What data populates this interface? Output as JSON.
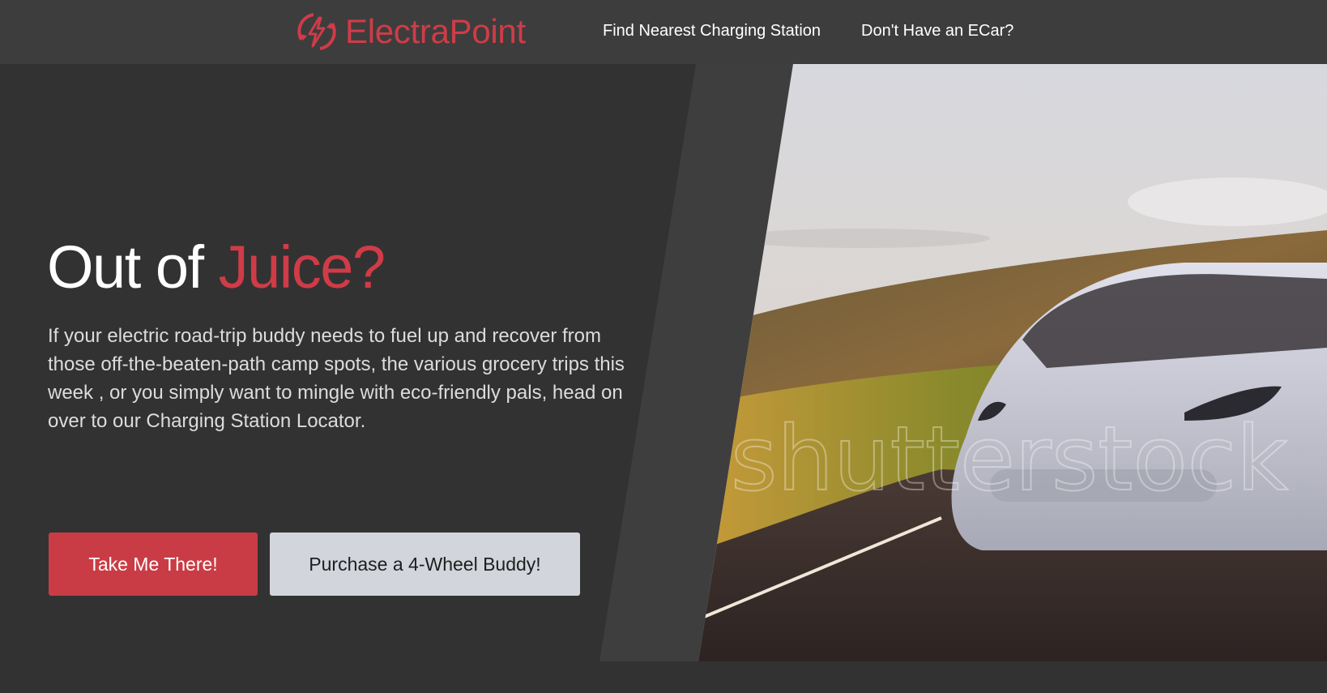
{
  "brand": {
    "name": "ElectraPoint",
    "icon": "lightning-bolt-icon",
    "color": "#cf3c47"
  },
  "nav": {
    "links": [
      {
        "label": "Find Nearest Charging Station"
      },
      {
        "label": "Don't Have an ECar?"
      }
    ]
  },
  "hero": {
    "headline_prefix": "Out of ",
    "headline_accent": "Juice?",
    "body": "If your electric road-trip buddy needs to fuel up and recover from those off-the-beaten-path camp spots, the various grocery trips this week , or you simply want to mingle with eco-friendly pals, head on over to our Charging Station Locator.",
    "primary_button": "Take Me There!",
    "secondary_button": "Purchase a 4-Wheel Buddy!",
    "watermark": "shutterstock"
  },
  "colors": {
    "accent": "#cf3c47",
    "button_primary": "#c93c45",
    "button_secondary": "#d2d5db",
    "background": "#323232",
    "navbar": "#3d3d3d"
  }
}
